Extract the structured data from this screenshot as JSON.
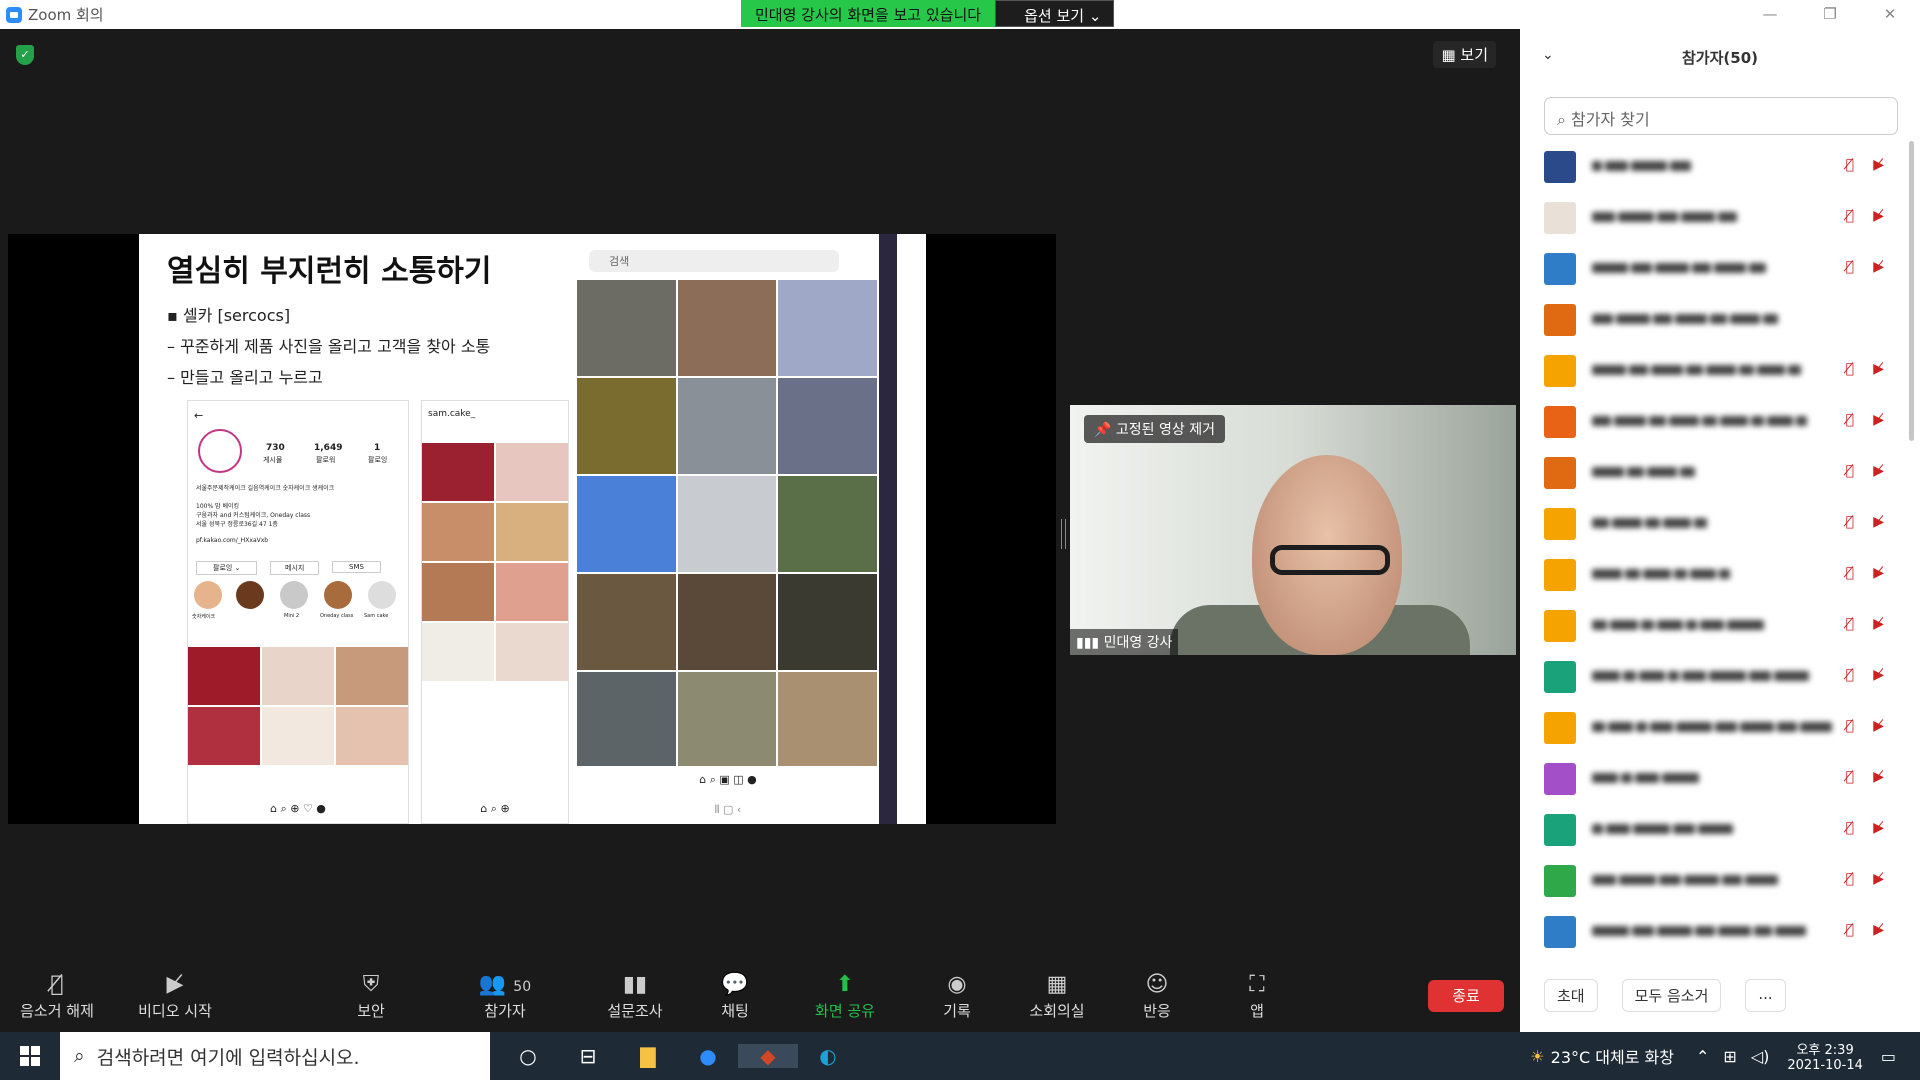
{
  "window": {
    "title": "Zoom 회의",
    "minimize": "—",
    "restore": "❐",
    "close": "✕"
  },
  "banner": {
    "sharing_text": "민대영 강사의 화면을 보고 있습니다",
    "options": "옵션 보기 ⌄"
  },
  "view_button": "보기",
  "slide": {
    "title": "열심히 부지런히 소통하기",
    "bullet1": "▪ 셀카 [sercocs]",
    "bullet2": "– 꾸준하게 제품 사진을 올리고 고객을 찾아 소통",
    "bullet3": "– 만들고 올리고 누르고",
    "profile": {
      "posts": "730",
      "posts_label": "게시물",
      "followers": "1,649",
      "followers_label": "팔로워",
      "following": "1",
      "following_label": "팔로잉",
      "bio1": "서울주문제작케이크 길음역케이크 숫자케이크 생케이크",
      "bio2": "100% 맘 베이킹",
      "bio3": "구움과자 and 커스텀케이크, Oneday class",
      "bio4": "서울 성북구 정릉로36길 47 1층",
      "bio5": "pf.kakao.com/_HXxaVxb",
      "follow_btn": "팔로잉 ⌄",
      "msg_btn": "메시지",
      "sms_btn": "SMS",
      "highlights": [
        "숫자케이크",
        "",
        "Mini 2",
        "Oneday class",
        "Sam cake"
      ]
    },
    "phone2_handle": "sam.cake_",
    "phone3_search": "검색"
  },
  "video": {
    "unpin": "고정된 영상 제거",
    "name": "민대영 강사"
  },
  "toolbar": {
    "mute": "음소거 해제",
    "video": "비디오 시작",
    "security": "보안",
    "participants": "참가자",
    "participants_count": "50",
    "poll": "설문조사",
    "chat": "채팅",
    "share": "화면 공유",
    "record": "기록",
    "breakout": "소회의실",
    "reaction": "반응",
    "apps": "앱",
    "end": "종료"
  },
  "panel": {
    "title": "참가자(50)",
    "search_placeholder": "참가자 찾기",
    "invite": "초대",
    "mute_all": "모두 음소거",
    "more": "...",
    "avatar_colors": [
      "#2b4a8a",
      "#e9e0d8",
      "#2f7dc7",
      "#e06a12",
      "#f5a300",
      "#e86316",
      "#e06a12",
      "#f5a300",
      "#f5a300",
      "#f5a300",
      "#1aa37a",
      "#f5a300",
      "#a34fc8",
      "#1aa37a",
      "#2fa84a",
      "#2f7dc7"
    ]
  },
  "taskbar": {
    "search": "검색하려면 여기에 입력하십시오.",
    "weather": "23°C  대체로 화창",
    "time": "오후 2:39",
    "date": "2021-10-14"
  }
}
